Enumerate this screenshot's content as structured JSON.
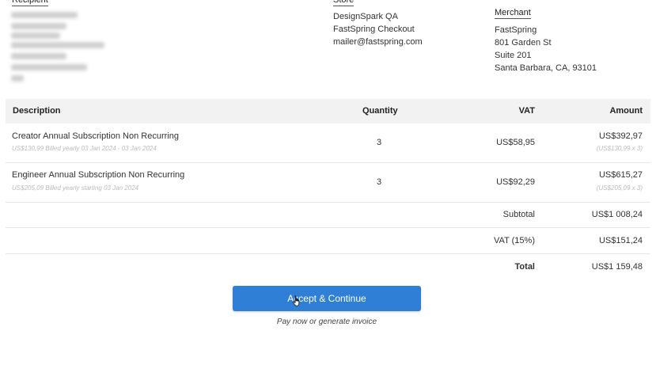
{
  "recipient": {
    "label": "Recipient"
  },
  "store": {
    "label": "Store",
    "lines": [
      "DesignSpark QA",
      "FastSpring Checkout",
      "mailer@fastspring.com"
    ]
  },
  "merchant": {
    "label": "Merchant",
    "lines": [
      "FastSpring",
      "801 Garden St",
      "Suite 201",
      "Santa Barbara, CA, 93101"
    ]
  },
  "table": {
    "headers": {
      "description": "Description",
      "quantity": "Quantity",
      "vat": "VAT",
      "amount": "Amount"
    },
    "items": [
      {
        "description": "Creator Annual Subscription Non Recurring",
        "detail": "US$130,99 Billed yearly 03 Jan 2024 - 03 Jan 2024",
        "quantity": "3",
        "vat": "US$58,95",
        "amount": "US$392,97",
        "amount_detail": "(US$130,99 x 3)"
      },
      {
        "description": "Engineer Annual Subscription Non Recurring",
        "detail": "US$205,09 Billed yearly starting 03 Jan 2024",
        "quantity": "3",
        "vat": "US$92,29",
        "amount": "US$615,27",
        "amount_detail": "(US$205,09 x 3)"
      }
    ],
    "subtotal_label": "Subtotal",
    "subtotal_value": "US$1 008,24",
    "vat_label": "VAT (15%)",
    "vat_value": "US$151,24",
    "total_label": "Total",
    "total_value": "US$1 159,48"
  },
  "actions": {
    "accept_label": "Accept & Continue",
    "note": "Pay now or generate invoice",
    "accent_color": "#2f7fd6"
  }
}
